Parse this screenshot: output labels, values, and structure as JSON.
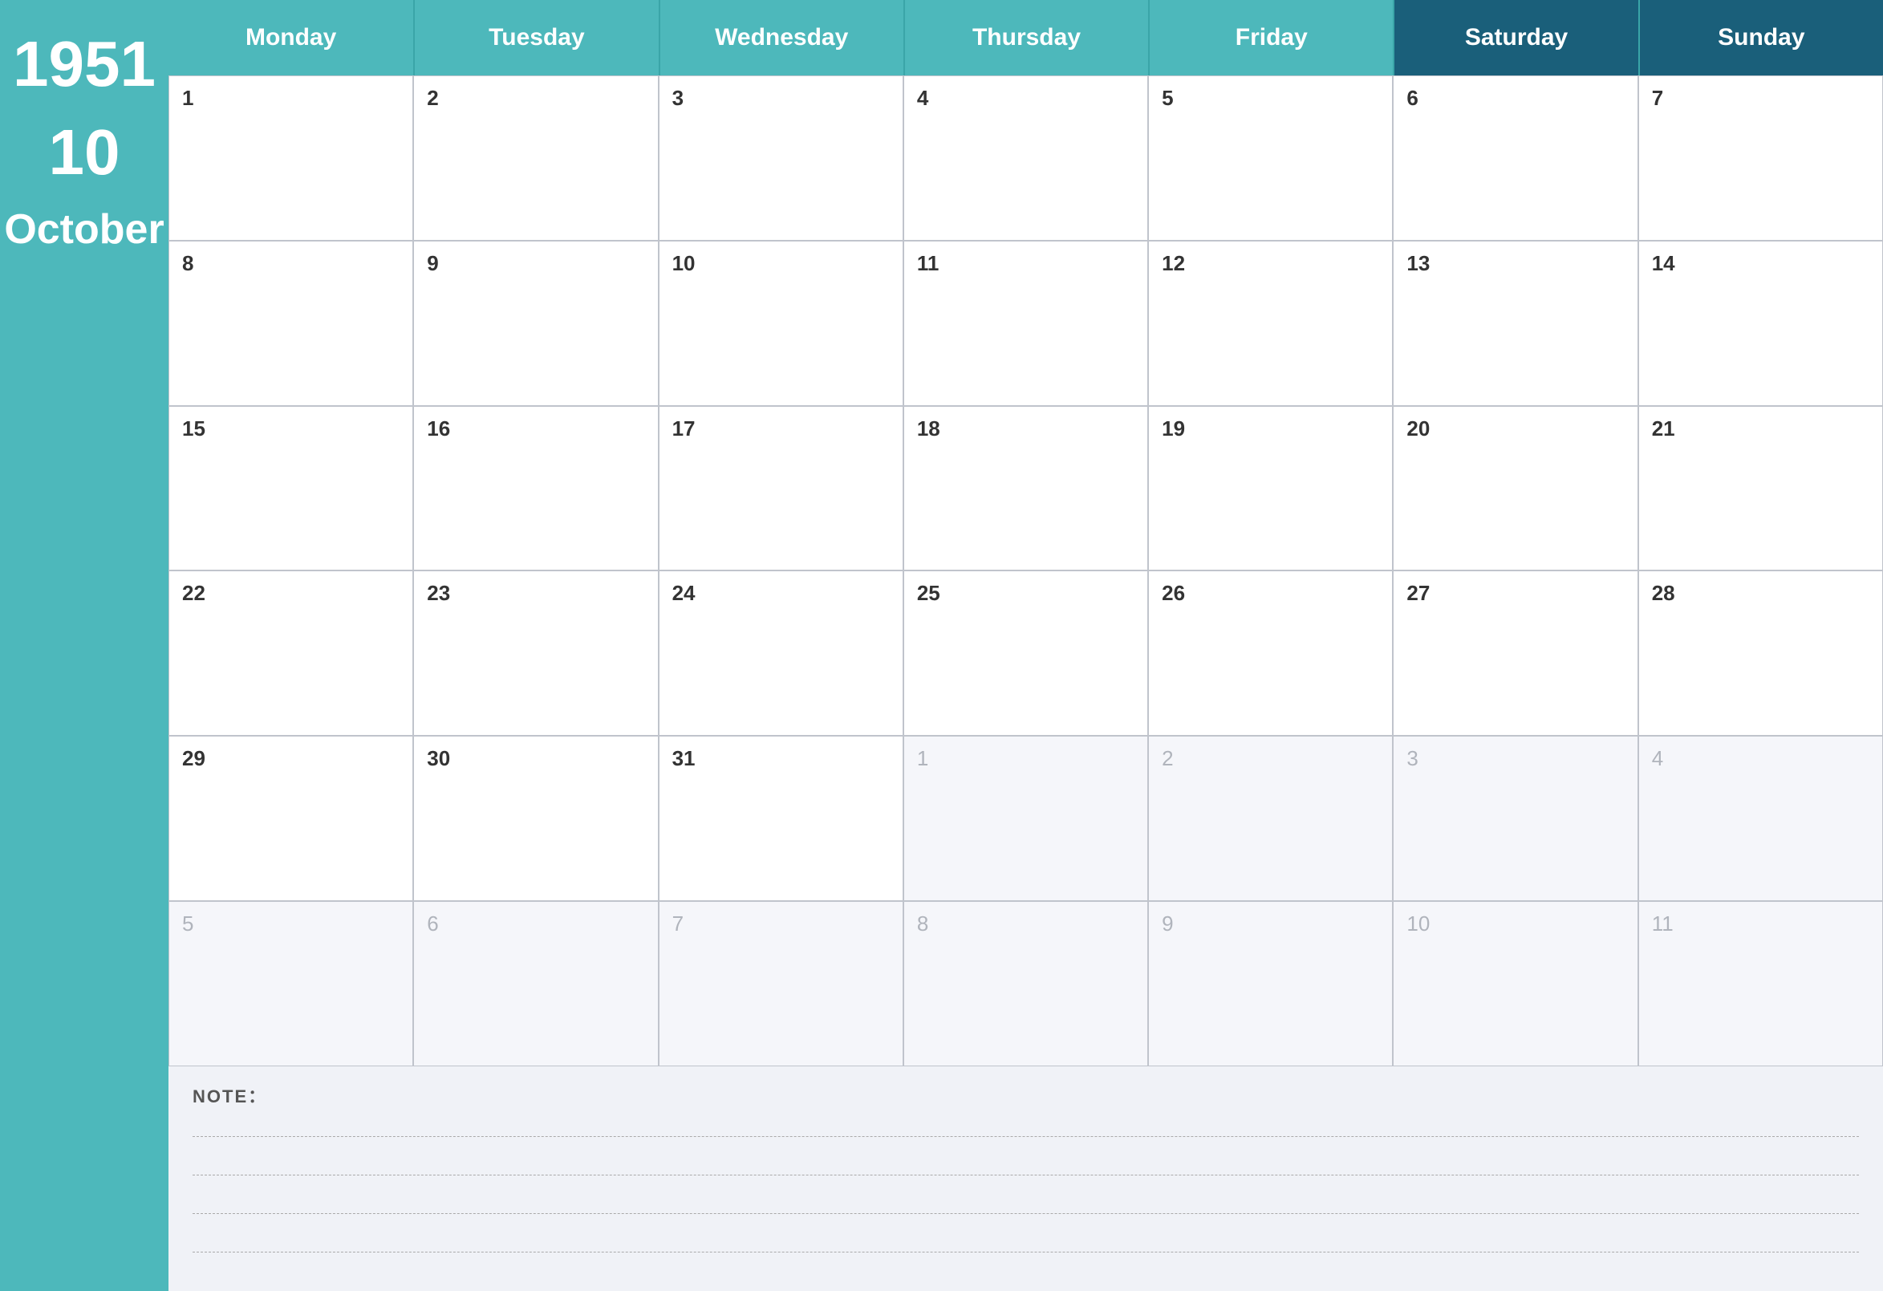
{
  "sidebar": {
    "year": "1951",
    "week_number": "10",
    "month": "October"
  },
  "header": {
    "days": [
      {
        "label": "Monday",
        "class": "weekday"
      },
      {
        "label": "Tuesday",
        "class": "weekday"
      },
      {
        "label": "Wednesday",
        "class": "weekday"
      },
      {
        "label": "Thursday",
        "class": "weekday"
      },
      {
        "label": "Friday",
        "class": "weekday"
      },
      {
        "label": "Saturday",
        "class": "saturday"
      },
      {
        "label": "Sunday",
        "class": "sunday"
      }
    ]
  },
  "weeks": [
    {
      "days": [
        {
          "number": "1",
          "other": false
        },
        {
          "number": "2",
          "other": false
        },
        {
          "number": "3",
          "other": false
        },
        {
          "number": "4",
          "other": false
        },
        {
          "number": "5",
          "other": false
        },
        {
          "number": "6",
          "other": false
        },
        {
          "number": "7",
          "other": false
        }
      ]
    },
    {
      "days": [
        {
          "number": "8",
          "other": false
        },
        {
          "number": "9",
          "other": false
        },
        {
          "number": "10",
          "other": false
        },
        {
          "number": "11",
          "other": false
        },
        {
          "number": "12",
          "other": false
        },
        {
          "number": "13",
          "other": false
        },
        {
          "number": "14",
          "other": false
        }
      ]
    },
    {
      "days": [
        {
          "number": "15",
          "other": false
        },
        {
          "number": "16",
          "other": false
        },
        {
          "number": "17",
          "other": false
        },
        {
          "number": "18",
          "other": false
        },
        {
          "number": "19",
          "other": false
        },
        {
          "number": "20",
          "other": false
        },
        {
          "number": "21",
          "other": false
        }
      ]
    },
    {
      "days": [
        {
          "number": "22",
          "other": false
        },
        {
          "number": "23",
          "other": false
        },
        {
          "number": "24",
          "other": false
        },
        {
          "number": "25",
          "other": false
        },
        {
          "number": "26",
          "other": false
        },
        {
          "number": "27",
          "other": false
        },
        {
          "number": "28",
          "other": false
        }
      ]
    },
    {
      "days": [
        {
          "number": "29",
          "other": false
        },
        {
          "number": "30",
          "other": false
        },
        {
          "number": "31",
          "other": false
        },
        {
          "number": "1",
          "other": true
        },
        {
          "number": "2",
          "other": true
        },
        {
          "number": "3",
          "other": true
        },
        {
          "number": "4",
          "other": true
        }
      ]
    },
    {
      "days": [
        {
          "number": "5",
          "other": true
        },
        {
          "number": "6",
          "other": true
        },
        {
          "number": "7",
          "other": true
        },
        {
          "number": "8",
          "other": true
        },
        {
          "number": "9",
          "other": true
        },
        {
          "number": "10",
          "other": true
        },
        {
          "number": "11",
          "other": true
        }
      ]
    }
  ],
  "note": {
    "label": "NOTE："
  }
}
